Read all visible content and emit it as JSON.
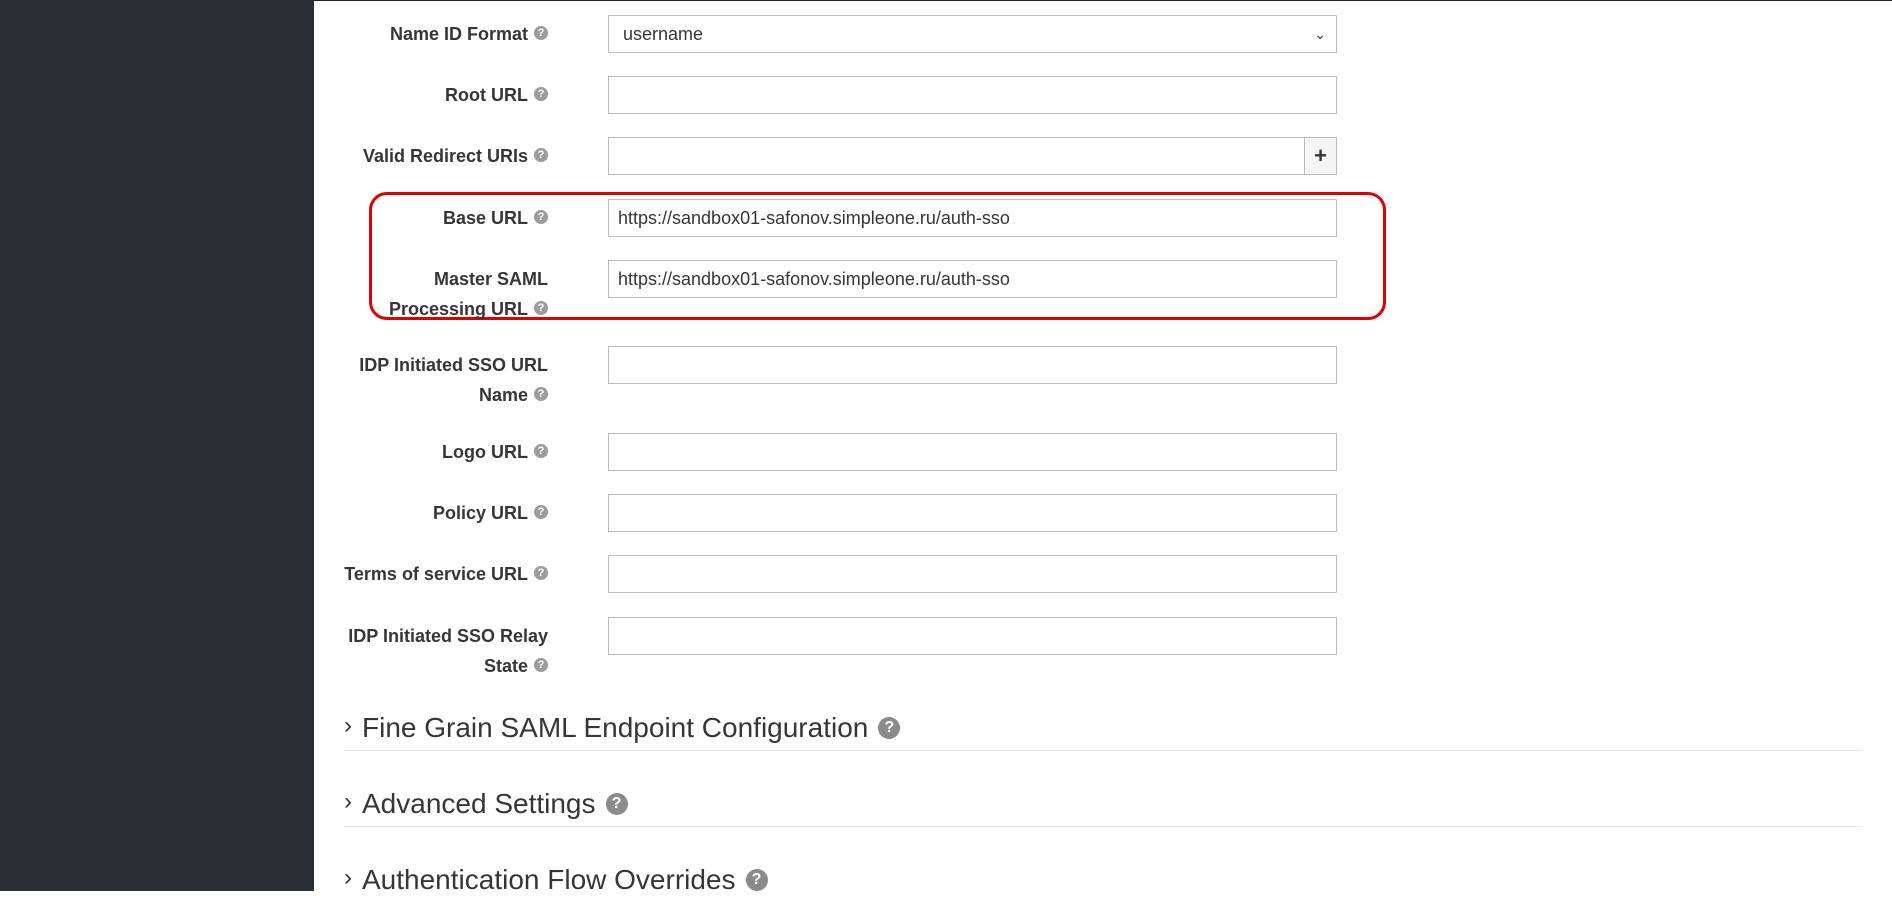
{
  "form": {
    "name_id_format": {
      "label": "Name ID Format",
      "value": "username"
    },
    "root_url": {
      "label": "Root URL",
      "value": ""
    },
    "valid_redirect_uris": {
      "label": "Valid Redirect URIs",
      "value": "",
      "add_label": "+"
    },
    "base_url": {
      "label": "Base URL",
      "value": "https://sandbox01-safonov.simpleone.ru/auth-sso"
    },
    "master_saml": {
      "label_line1": "Master SAML",
      "label_line2": "Processing URL",
      "value": "https://sandbox01-safonov.simpleone.ru/auth-sso"
    },
    "idp_sso_url_name": {
      "label_line1": "IDP Initiated SSO URL",
      "label_line2": "Name",
      "value": ""
    },
    "logo_url": {
      "label": "Logo URL",
      "value": ""
    },
    "policy_url": {
      "label": "Policy URL",
      "value": ""
    },
    "terms_url": {
      "label": "Terms of service URL",
      "value": ""
    },
    "idp_relay_state": {
      "label_line1": "IDP Initiated SSO Relay",
      "label_line2": "State",
      "value": ""
    }
  },
  "sections": [
    {
      "title": "Fine Grain SAML Endpoint Configuration"
    },
    {
      "title": "Advanced Settings"
    },
    {
      "title": "Authentication Flow Overrides"
    }
  ],
  "help_glyph": "?",
  "caret_glyph": "›",
  "highlight_color": "#e00000"
}
